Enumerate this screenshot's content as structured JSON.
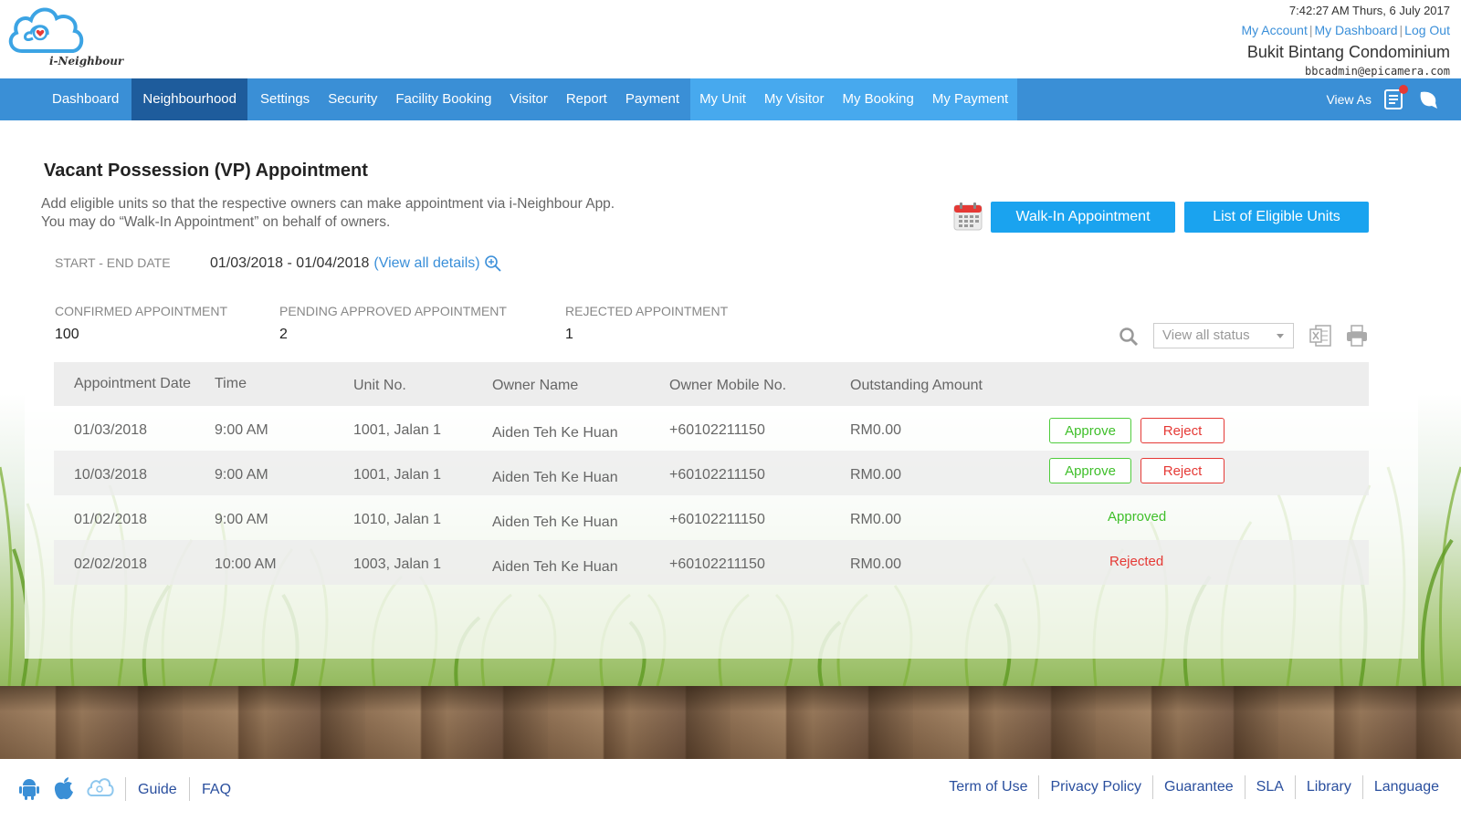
{
  "header": {
    "logo_text": "i-Neighbour",
    "datetime": "7:42:27 AM  Thurs, 6 July 2017",
    "links": [
      "My Account",
      "My Dashboard",
      "Log Out"
    ],
    "condo_name": "Bukit Bintang Condominium",
    "email": "bbcadmin@epicamera.com"
  },
  "nav": {
    "items": [
      "Dashboard",
      "Neighbourhood",
      "Settings",
      "Security",
      "Facility Booking",
      "Visitor",
      "Report",
      "Payment"
    ],
    "user_items": [
      "My Unit",
      "My Visitor",
      "My Booking",
      "My Payment"
    ],
    "view_as": "View As",
    "icons": [
      "notes-icon",
      "chat-icon"
    ]
  },
  "page": {
    "title": "Vacant Possession (VP) Appointment",
    "desc_line1": "Add eligible units so that the respective owners can make appointment via i-Neighbour App.",
    "desc_line2": "You may do “Walk-In Appointment” on behalf of owners.",
    "walkin_button": "Walk-In Appointment",
    "eligible_button": "List of Eligible Units",
    "date_label": "START - END DATE",
    "date_range": "01/03/2018 - 01/04/2018",
    "view_details": "(View all details)"
  },
  "stats": [
    {
      "label": "CONFIRMED APPOINTMENT",
      "value": "100"
    },
    {
      "label": "PENDING APPROVED APPOINTMENT",
      "value": "2"
    },
    {
      "label": "REJECTED APPOINTMENT",
      "value": "1"
    }
  ],
  "filter": {
    "status_placeholder": "View all status"
  },
  "table": {
    "headers": [
      "Appointment Date",
      "Time",
      "Unit No.",
      "Owner Name",
      "Owner Mobile No.",
      "Outstanding Amount"
    ],
    "approve_label": "Approve",
    "reject_label": "Reject",
    "rows": [
      {
        "date": "01/03/2018",
        "time": "9:00 AM",
        "unit": "1001, Jalan 1",
        "owner": "Aiden Teh Ke Huan",
        "mobile": "+60102211150",
        "amount": "RM0.00",
        "status": ""
      },
      {
        "date": "10/03/2018",
        "time": "9:00 AM",
        "unit": "1001, Jalan 1",
        "owner": "Aiden Teh Ke Huan",
        "mobile": "+60102211150",
        "amount": "RM0.00",
        "status": ""
      },
      {
        "date": "01/02/2018",
        "time": "9:00 AM",
        "unit": "1010, Jalan 1",
        "owner": "Aiden Teh Ke Huan",
        "mobile": "+60102211150",
        "amount": "RM0.00",
        "status": "Approved"
      },
      {
        "date": "02/02/2018",
        "time": "10:00 AM",
        "unit": "1003, Jalan 1",
        "owner": "Aiden Teh Ke Huan",
        "mobile": "+60102211150",
        "amount": "RM0.00",
        "status": "Rejected"
      }
    ]
  },
  "footer": {
    "left_links": [
      "Guide",
      "FAQ"
    ],
    "right_links": [
      "Term of Use",
      "Privacy Policy",
      "Guarantee",
      "SLA",
      "Library",
      "Language"
    ]
  },
  "colors": {
    "nav_bg": "#3a8fd6",
    "nav_active": "#1e5c9c",
    "nav_user_bg": "#47a9ee",
    "primary_button": "#1aa3ef",
    "approve": "#3fbf2a",
    "reject": "#e53935"
  }
}
